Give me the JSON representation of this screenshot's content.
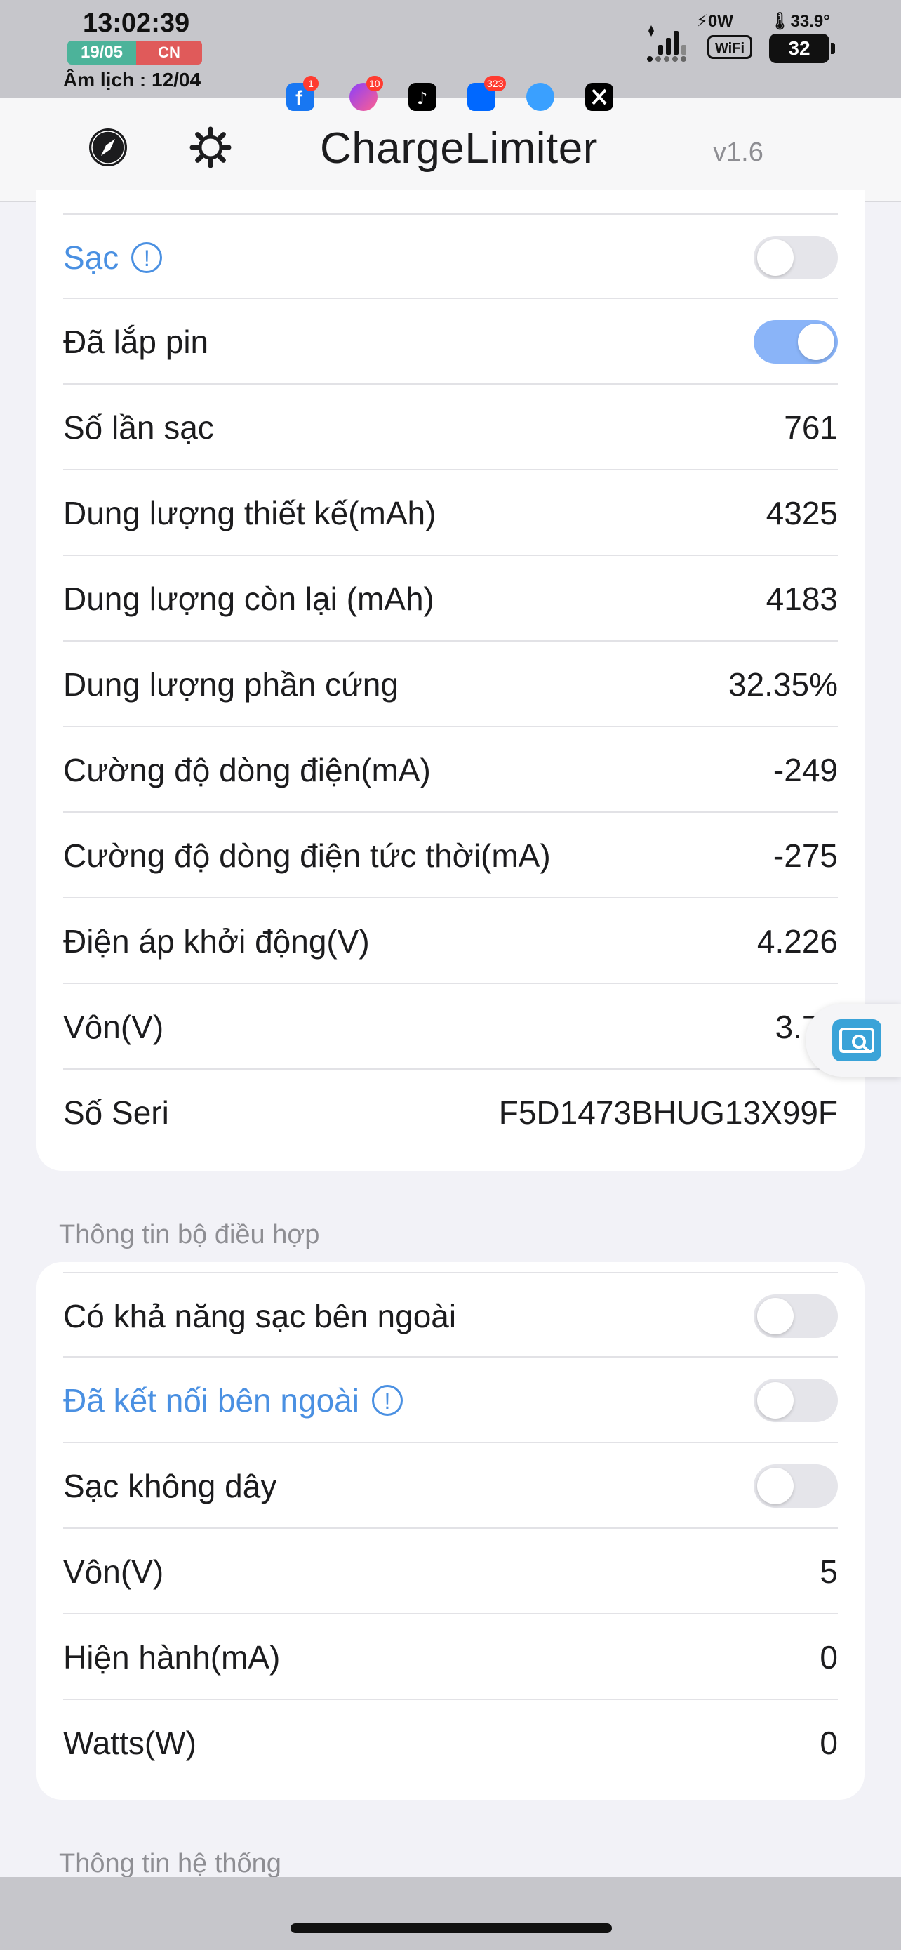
{
  "status_bar": {
    "time": "13:02:39",
    "date": "19/05",
    "day": "CN",
    "lunar": "Âm lịch : 12/04",
    "power": "0W",
    "temperature": "33.9°",
    "wifi_label": "WiFi",
    "battery": "32"
  },
  "app_icons": [
    {
      "name": "facebook",
      "badge": "1"
    },
    {
      "name": "messenger",
      "badge": "10"
    },
    {
      "name": "tiktok",
      "badge": ""
    },
    {
      "name": "zalo",
      "badge": "323"
    },
    {
      "name": "safari",
      "badge": ""
    },
    {
      "name": "x",
      "badge": ""
    }
  ],
  "navbar": {
    "title": "ChargeLimiter",
    "version": "v1.6"
  },
  "battery_section": {
    "rows": [
      {
        "label": "Sạc",
        "type": "toggle",
        "on": false,
        "info": true
      },
      {
        "label": "Đã lắp pin",
        "type": "toggle",
        "on": true
      },
      {
        "label": "Số lần sạc",
        "value": "761"
      },
      {
        "label": "Dung lượng thiết kế(mAh)",
        "value": "4325"
      },
      {
        "label": "Dung lượng còn lại (mAh)",
        "value": "4183"
      },
      {
        "label": "Dung lượng phần cứng",
        "value": "32.35%"
      },
      {
        "label": "Cường độ dòng điện(mA)",
        "value": "-249"
      },
      {
        "label": "Cường độ dòng điện tức thời(mA)",
        "value": "-275"
      },
      {
        "label": "Điện áp khởi động(V)",
        "value": "4.226"
      },
      {
        "label": "Vôn(V)",
        "value": "3.77"
      },
      {
        "label": "Số Seri",
        "value": "F5D1473BHUG13X99F"
      }
    ]
  },
  "adapter_section": {
    "header": "Thông tin bộ điều hợp",
    "rows": [
      {
        "label": "Có khả năng sạc bên ngoài",
        "type": "toggle",
        "on": false
      },
      {
        "label": "Đã kết nối bên ngoài",
        "type": "toggle",
        "on": false,
        "info": true
      },
      {
        "label": "Sạc không dây",
        "type": "toggle",
        "on": false
      },
      {
        "label": "Vôn(V)",
        "value": "5"
      },
      {
        "label": "Hiện hành(mA)",
        "value": "0"
      },
      {
        "label": "Watts(W)",
        "value": "0"
      }
    ]
  },
  "system_section": {
    "header": "Thông tin hệ thống"
  },
  "info_glyph": "!"
}
